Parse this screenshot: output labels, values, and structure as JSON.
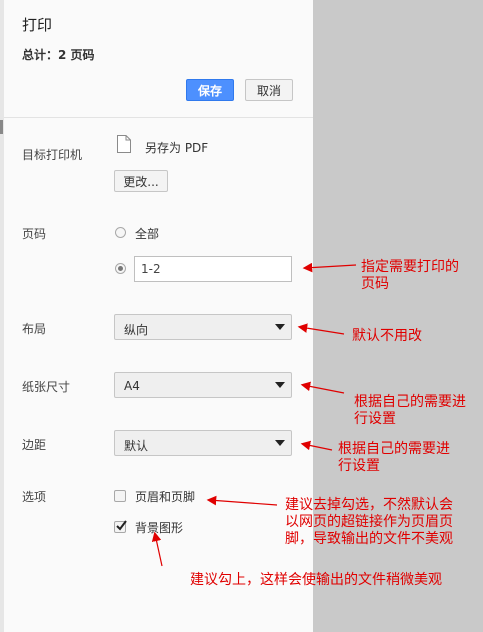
{
  "dialog": {
    "title": "打印",
    "total": "总计：2 页码",
    "save": "保存",
    "cancel": "取消"
  },
  "destination": {
    "label": "目标打印机",
    "name": "另存为 PDF",
    "change": "更改..."
  },
  "pages": {
    "label": "页码",
    "all": "全部",
    "custom_value": "1-2"
  },
  "layout": {
    "label": "布局",
    "value": "纵向"
  },
  "paper_size": {
    "label": "纸张尺寸",
    "value": "A4"
  },
  "margins": {
    "label": "边距",
    "value": "默认"
  },
  "options": {
    "label": "选项",
    "headers_footers": "页眉和页脚",
    "headers_footers_checked": false,
    "background_graphics": "背景图形",
    "background_graphics_checked": true
  },
  "annotations": {
    "pages_line1": "指定需要打印的",
    "pages_line2": "页码",
    "layout": "默认不用改",
    "paper_line1": "根据自己的需要进",
    "paper_line2": "行设置",
    "margins_line1": "根据自己的需要进",
    "margins_line2": "行设置",
    "headers_line1": "建议去掉勾选，不然默认会",
    "headers_line2": "以网页的超链接作为页眉页",
    "headers_line3": "脚，导致输出的文件不美观",
    "background": "建议勾上，这样会使输出的文件稍微美观"
  },
  "colors": {
    "accent": "#4d90fe",
    "annotation": "#e00000",
    "preview_bg": "#c9c9c9"
  }
}
